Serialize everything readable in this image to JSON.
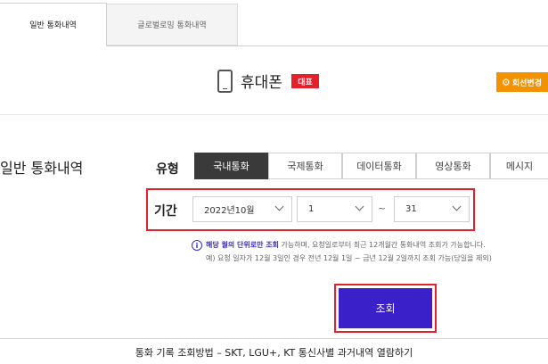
{
  "tabs": [
    {
      "label": "일반 통화내역",
      "active": true
    },
    {
      "label": "글로벌로밍 통화내역",
      "active": false
    }
  ],
  "device": {
    "icon": "smartphone-icon",
    "label": "휴대폰",
    "badge": "대표",
    "change_button": "회선변경",
    "change_icon": "gear-icon"
  },
  "section_title": "일반 통화내역",
  "filter": {
    "type_label": "유형",
    "types": [
      "국내통화",
      "국제통화",
      "데이터통화",
      "영상통화",
      "메시지"
    ],
    "selected_type": "국내통화",
    "period_label": "기간",
    "month": "2022년10월",
    "start_day": "1",
    "separator": "~",
    "end_day": "31"
  },
  "info": {
    "icon": "info-icon",
    "highlight": "해당 월의 단위로만 조회",
    "line1_rest": " 가능하며, 요청일로부터 최근 12개월간 통화내역 조회가 가능합니다.",
    "line2": "예) 요청 일자가 12월 3일인 경우 전년 12월 1일 ~ 금년 12월 2일까지 조회 가능(당일을 제외)"
  },
  "search_button": "조회",
  "caption": "통화 기록 조회방법 – SKT, LGU+, KT 통신사별 과거내역 열람하기",
  "colors": {
    "accent_red": "#e5202a",
    "primary_blue": "#3920c8",
    "orange": "#f39200",
    "active_dark": "#3a3a3a"
  }
}
